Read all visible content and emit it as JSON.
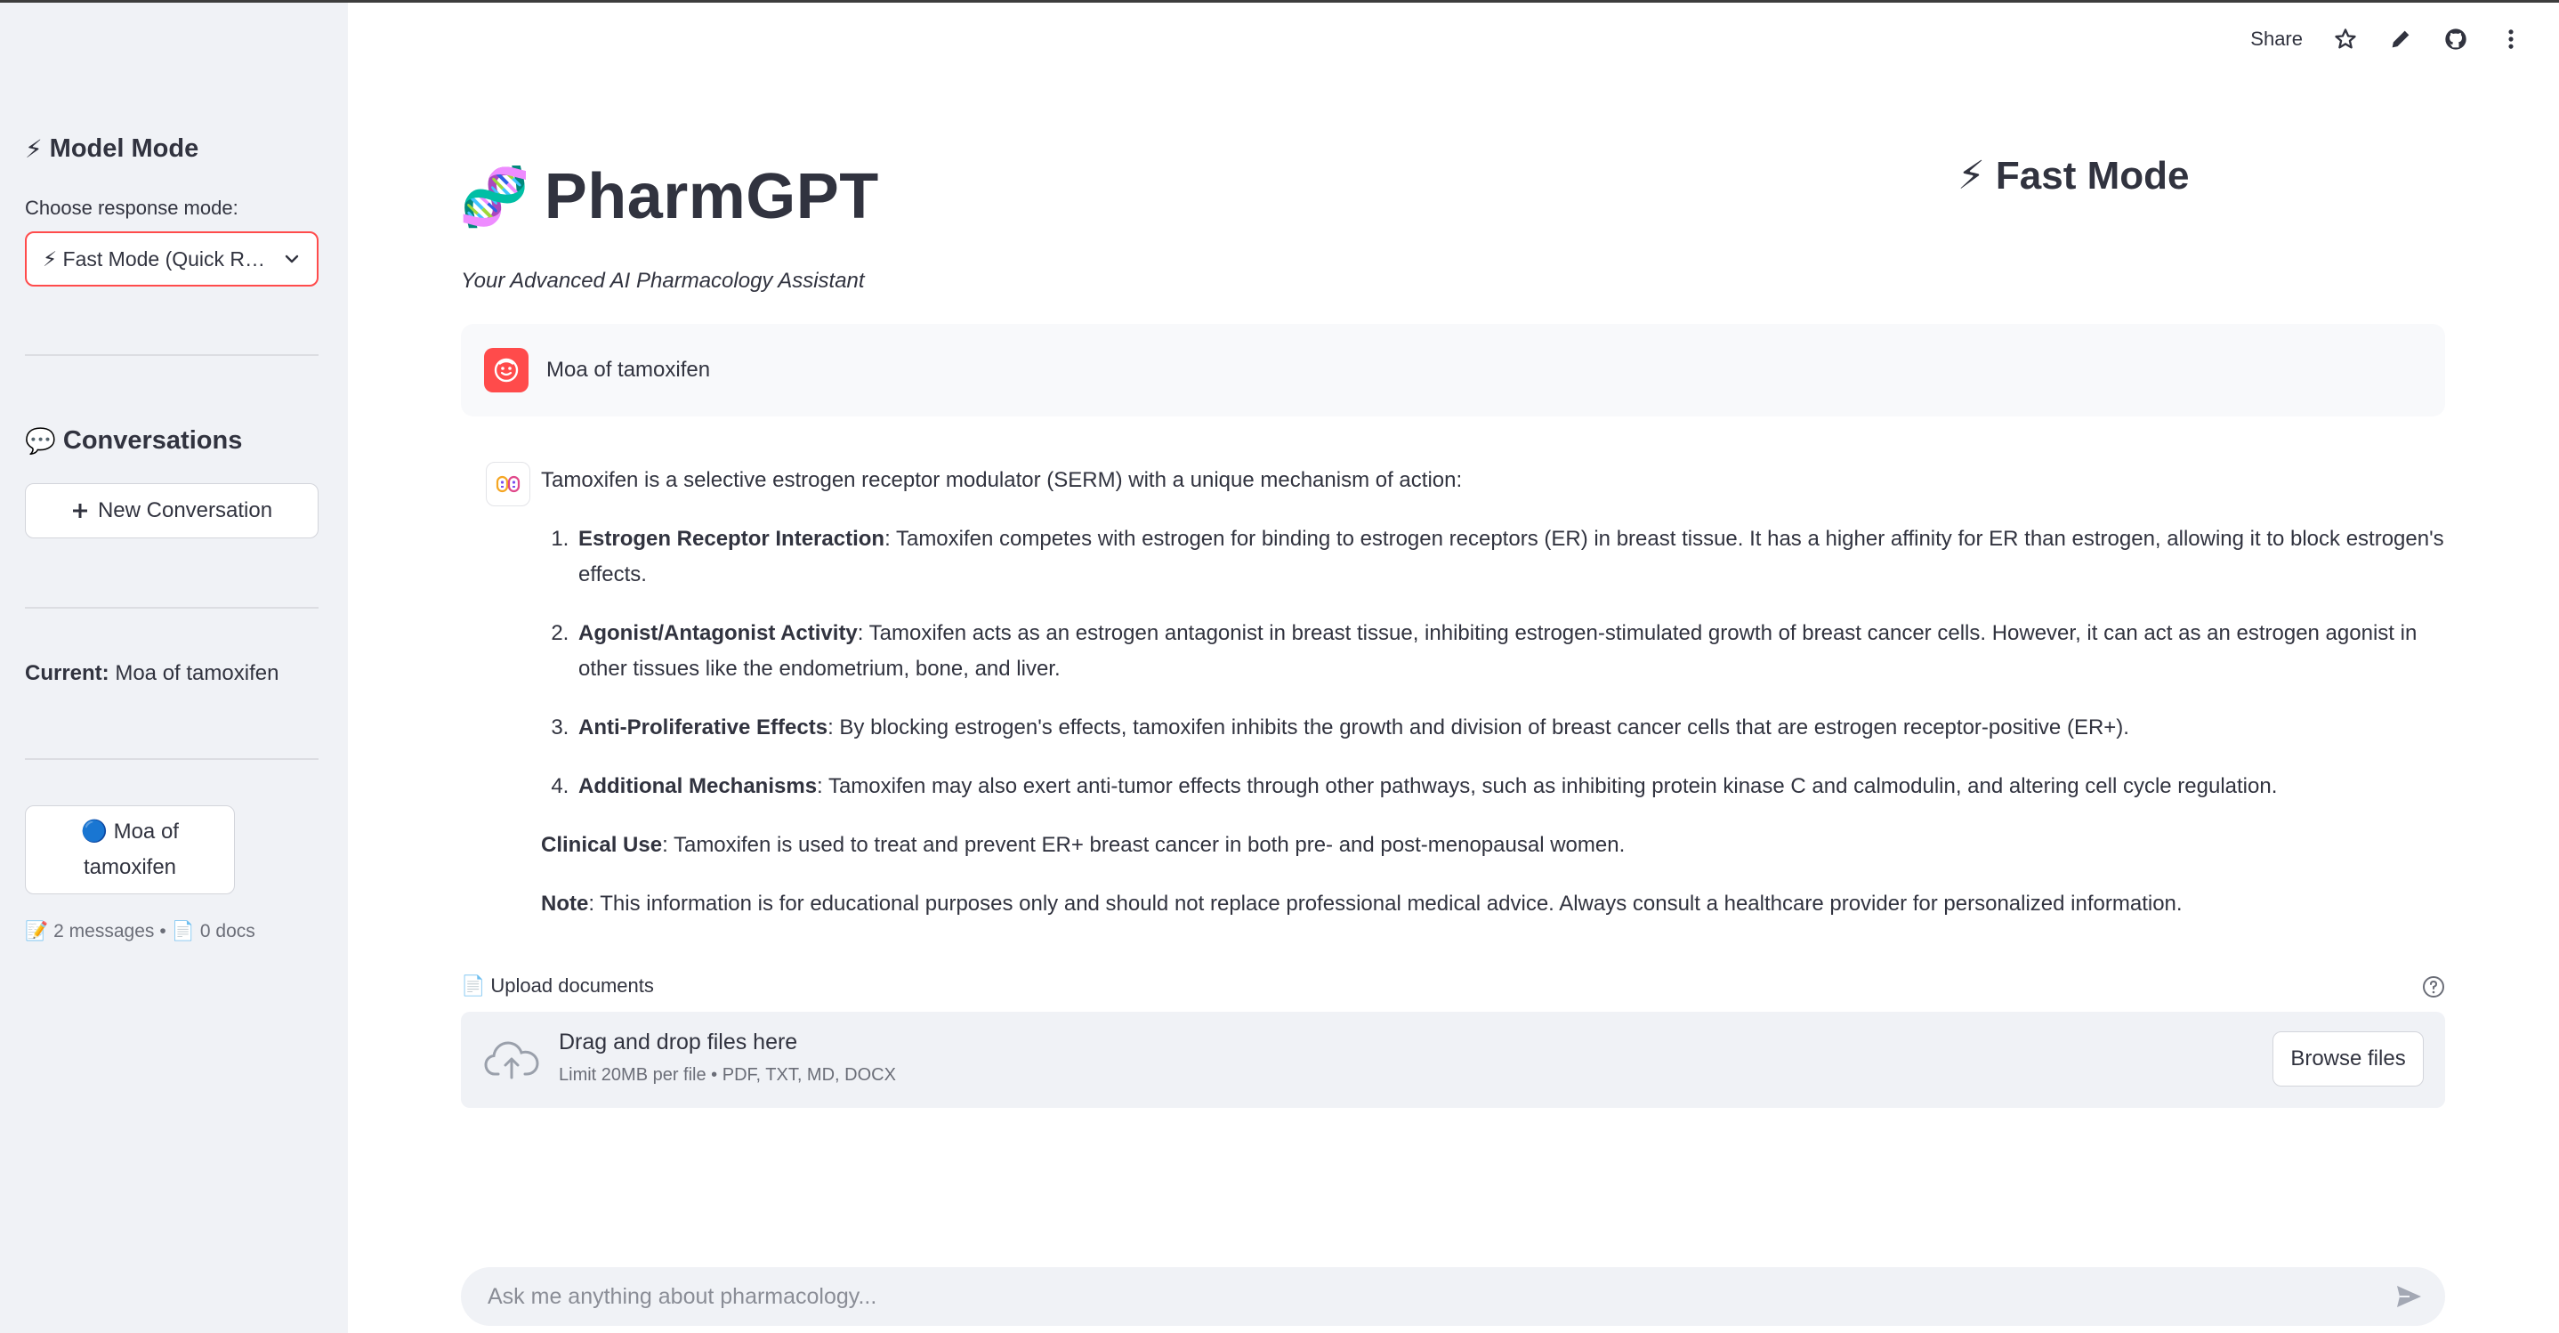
{
  "toolbar": {
    "share_label": "Share"
  },
  "sidebar": {
    "model_mode_heading": "Model Mode",
    "model_mode_icon": "⚡",
    "choose_label": "Choose response mode:",
    "select_value": "⚡ Fast Mode (Quick Responses)",
    "conversations_heading": "Conversations",
    "conversations_icon": "💬",
    "new_conversation_label": "New Conversation",
    "current_prefix": "Current:",
    "current_value": "Moa of tamoxifen",
    "conversation_item": {
      "icon": "🔵",
      "label": "Moa of tamoxifen"
    },
    "meta": {
      "messages_icon": "📝",
      "messages": "2 messages",
      "sep": "•",
      "docs_icon": "📄",
      "docs": "0 docs"
    }
  },
  "main": {
    "title_icon": "🧬",
    "title": "PharmGPT",
    "mode_icon": "⚡",
    "mode_label": "Fast Mode",
    "subtitle": "Your Advanced AI Pharmacology Assistant",
    "user_message": "Moa of tamoxifen",
    "assistant": {
      "intro": "Tamoxifen is a selective estrogen receptor modulator (SERM) with a unique mechanism of action:",
      "items": [
        {
          "title": "Estrogen Receptor Interaction",
          "text": ": Tamoxifen competes with estrogen for binding to estrogen receptors (ER) in breast tissue. It has a higher affinity for ER than estrogen, allowing it to block estrogen's effects."
        },
        {
          "title": "Agonist/Antagonist Activity",
          "text": ": Tamoxifen acts as an estrogen antagonist in breast tissue, inhibiting estrogen-stimulated growth of breast cancer cells. However, it can act as an estrogen agonist in other tissues like the endometrium, bone, and liver."
        },
        {
          "title": "Anti-Proliferative Effects",
          "text": ": By blocking estrogen's effects, tamoxifen inhibits the growth and division of breast cancer cells that are estrogen receptor-positive (ER+)."
        },
        {
          "title": "Additional Mechanisms",
          "text": ": Tamoxifen may also exert anti-tumor effects through other pathways, such as inhibiting protein kinase C and calmodulin, and altering cell cycle regulation."
        }
      ],
      "clinical_title": "Clinical Use",
      "clinical_text": ": Tamoxifen is used to treat and prevent ER+ breast cancer in both pre- and post-menopausal women.",
      "note_title": "Note",
      "note_text": ": This information is for educational purposes only and should not replace professional medical advice. Always consult a healthcare provider for personalized information."
    },
    "upload": {
      "icon": "📄",
      "label": "Upload documents",
      "drop_title": "Drag and drop files here",
      "drop_sub": "Limit 20MB per file • PDF, TXT, MD, DOCX",
      "browse_label": "Browse files"
    },
    "chat_placeholder": "Ask me anything about pharmacology..."
  },
  "colors": {
    "accent": "#ff4b4b",
    "sidebar_bg": "#f0f2f6",
    "text": "#31333f"
  }
}
